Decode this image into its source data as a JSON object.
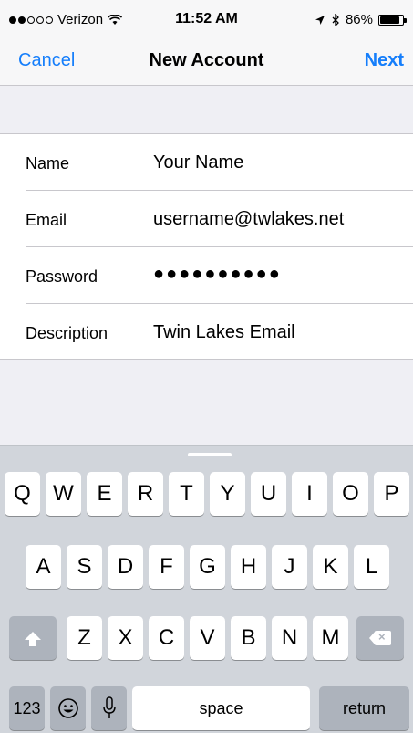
{
  "status_bar": {
    "carrier": "Verizon",
    "time": "11:52 AM",
    "battery": "86%",
    "battery_level": 0.86
  },
  "nav": {
    "cancel": "Cancel",
    "title": "New Account",
    "next": "Next"
  },
  "form": {
    "rows": [
      {
        "label": "Name",
        "value": "Your Name"
      },
      {
        "label": "Email",
        "value": "username@twlakes.net"
      },
      {
        "label": "Password",
        "value": "●●●●●●●●●●"
      },
      {
        "label": "Description",
        "value": "Twin Lakes Email"
      }
    ]
  },
  "keyboard": {
    "row1": [
      "Q",
      "W",
      "E",
      "R",
      "T",
      "Y",
      "U",
      "I",
      "O",
      "P"
    ],
    "row2": [
      "A",
      "S",
      "D",
      "F",
      "G",
      "H",
      "J",
      "K",
      "L"
    ],
    "row3": [
      "Z",
      "X",
      "C",
      "V",
      "B",
      "N",
      "M"
    ],
    "numbers": "123",
    "space": "space",
    "return": "return"
  }
}
